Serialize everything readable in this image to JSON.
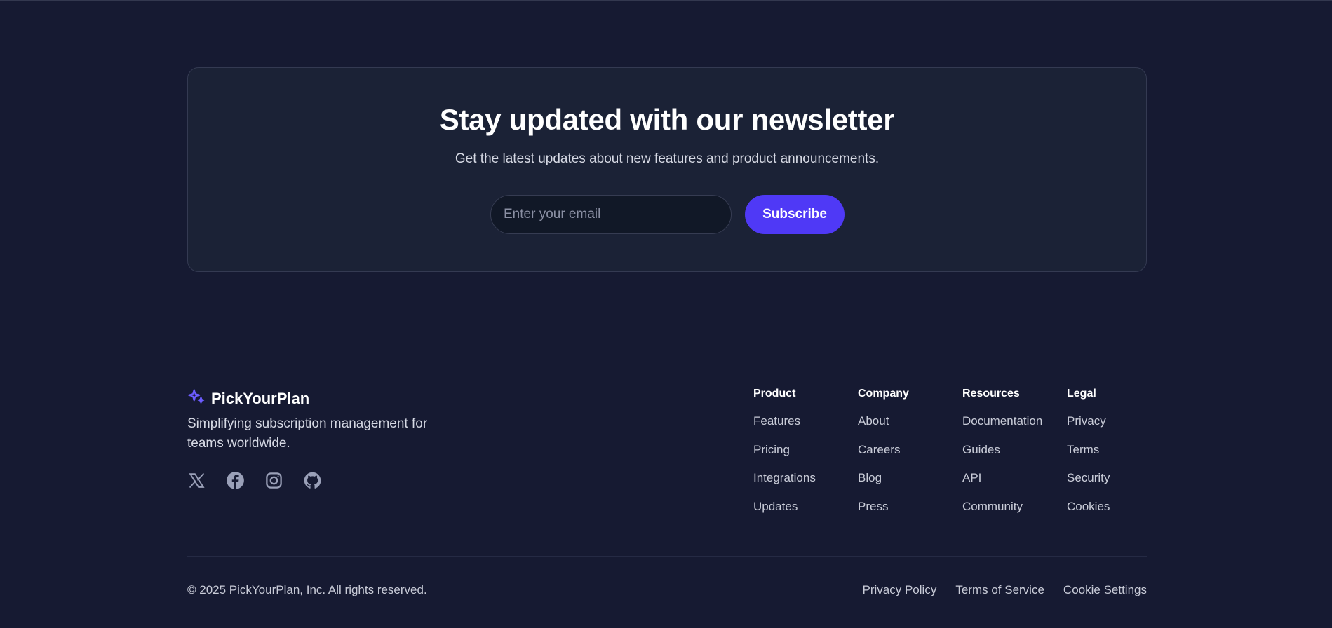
{
  "newsletter": {
    "title": "Stay updated with our newsletter",
    "subtitle": "Get the latest updates about new features and product announcements.",
    "email_placeholder": "Enter your email",
    "subscribe_label": "Subscribe"
  },
  "brand": {
    "name": "PickYourPlan",
    "icon": "sparkles-icon",
    "tagline": "Simplifying subscription management for teams worldwide.",
    "accent_color": "#6c5cff"
  },
  "socials": [
    {
      "icon": "x-twitter-icon"
    },
    {
      "icon": "facebook-icon"
    },
    {
      "icon": "instagram-icon"
    },
    {
      "icon": "github-icon"
    }
  ],
  "columns": [
    {
      "heading": "Product",
      "links": [
        "Features",
        "Pricing",
        "Integrations",
        "Updates"
      ]
    },
    {
      "heading": "Company",
      "links": [
        "About",
        "Careers",
        "Blog",
        "Press"
      ]
    },
    {
      "heading": "Resources",
      "links": [
        "Documentation",
        "Guides",
        "API",
        "Community"
      ]
    },
    {
      "heading": "Legal",
      "links": [
        "Privacy",
        "Terms",
        "Security",
        "Cookies"
      ]
    }
  ],
  "bottom": {
    "copyright": "© 2025 PickYourPlan, Inc. All rights reserved.",
    "links": [
      "Privacy Policy",
      "Terms of Service",
      "Cookie Settings"
    ]
  },
  "colors": {
    "background": "#161a32",
    "card": "#1b2236",
    "button": "#4f39f6"
  }
}
